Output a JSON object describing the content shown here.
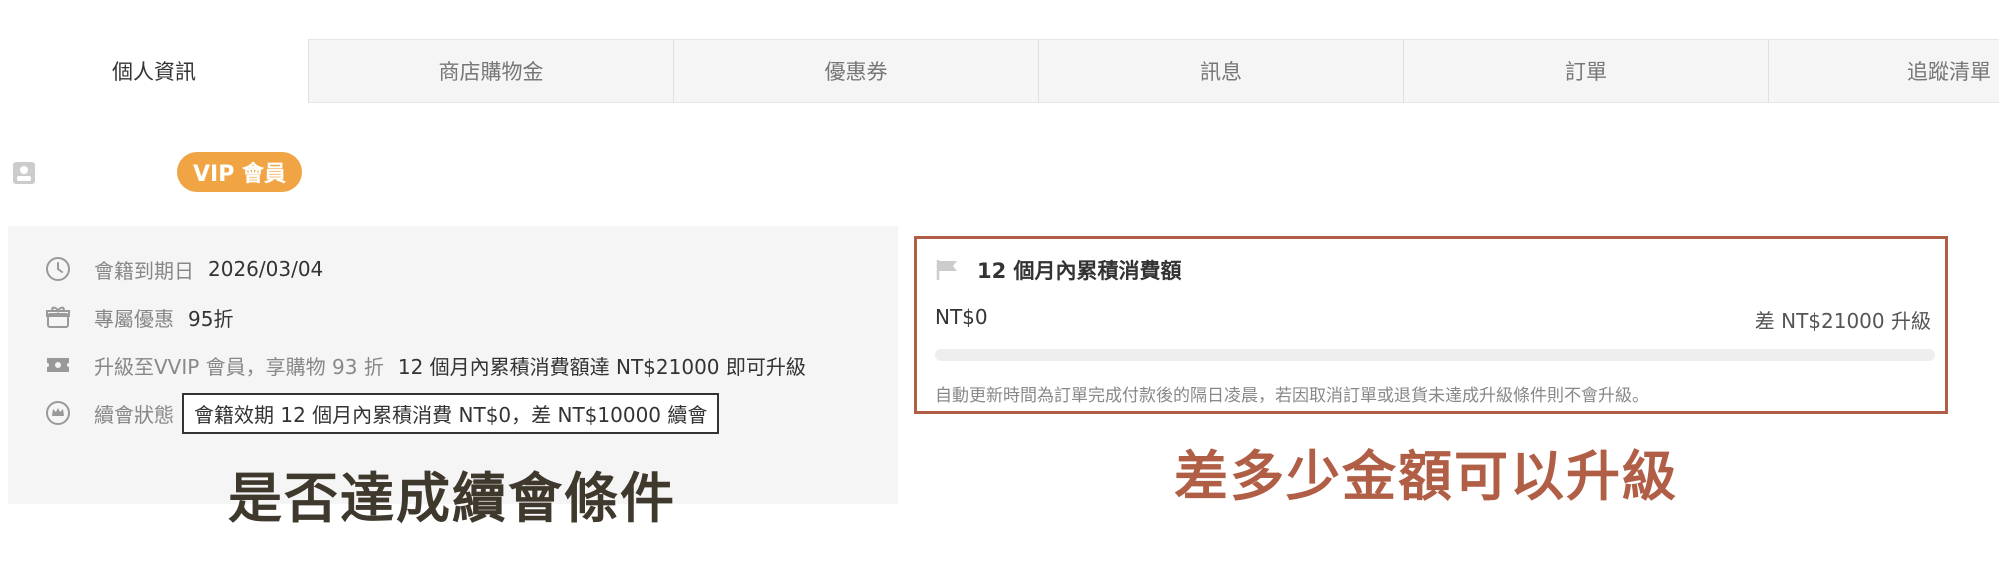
{
  "tabs": [
    {
      "label": "個人資訊",
      "active": true
    },
    {
      "label": "商店購物金",
      "active": false
    },
    {
      "label": "優惠券",
      "active": false
    },
    {
      "label": "訊息",
      "active": false
    },
    {
      "label": "訂單",
      "active": false
    },
    {
      "label": "追蹤清單",
      "active": false
    }
  ],
  "member": {
    "badge": "VIP 會員",
    "rows": {
      "expiry_label": "會籍到期日",
      "expiry_value": "2026/03/04",
      "discount_label": "專屬優惠",
      "discount_value": "95折",
      "upgrade_label": "升級至VVIP 會員，享購物 93 折",
      "upgrade_value": "12 個月內累積消費額達 NT$21000 即可升級",
      "renew_label": "續會狀態",
      "renew_value": "會籍效期 12 個月內累積消費 NT$0，差 NT$10000 續會"
    },
    "caption": "是否達成續會條件"
  },
  "spending": {
    "title": "12 個月內累積消費額",
    "amount": "NT$0",
    "diff": "差 NT$21000 升級",
    "progress": 0,
    "note": "自動更新時間為訂單完成付款後的隔日凌晨，若因取消訂單或退貨未達成升級條件則不會升級。",
    "caption": "差多少金額可以升級"
  },
  "colors": {
    "accent": "#f0a443",
    "highlight_border_right": "#b05e45",
    "caption_left": "#3f382c"
  },
  "icons": [
    "user-card-icon",
    "clock-icon",
    "gift-icon",
    "ticket-icon",
    "crown-icon",
    "flag-icon"
  ]
}
